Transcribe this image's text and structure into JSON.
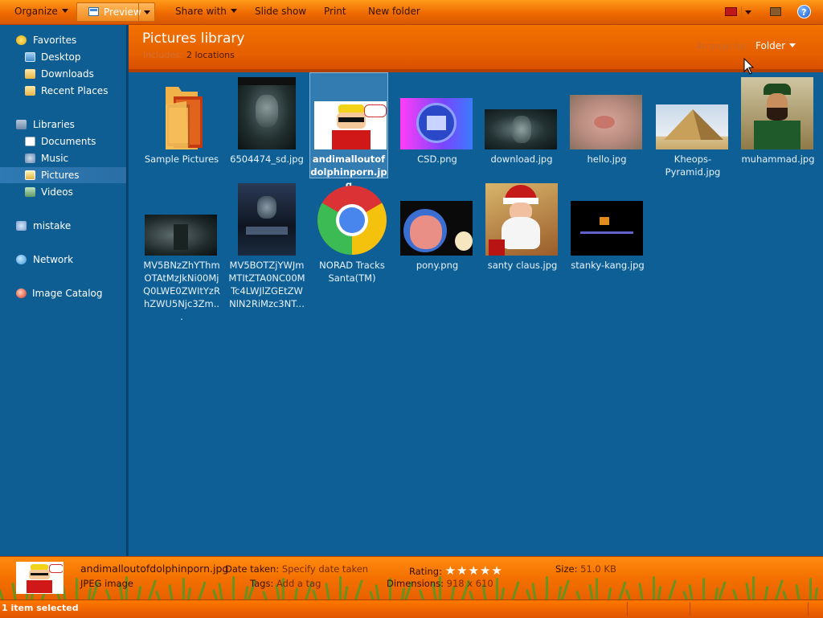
{
  "toolbar": {
    "organize": "Organize",
    "preview": "Preview",
    "share_with": "Share with",
    "slide_show": "Slide show",
    "print": "Print",
    "new_folder": "New folder",
    "help": "?"
  },
  "sidebar": {
    "favorites": "Favorites",
    "favorites_items": [
      "Desktop",
      "Downloads",
      "Recent Places"
    ],
    "libraries": "Libraries",
    "libraries_items": [
      "Documents",
      "Music",
      "Pictures",
      "Videos"
    ],
    "selected": "Pictures",
    "homegroup": "mistake",
    "network": "Network",
    "image_catalog": "Image Catalog"
  },
  "header": {
    "title": "Pictures library",
    "includes": "Includes:",
    "locations": "2 locations",
    "arrange_by_label": "Arrange by:",
    "arrange_by_value": "Folder"
  },
  "files": [
    {
      "name": "Sample Pictures",
      "thumb": "folder-icon"
    },
    {
      "name": "6504474_sd.jpg",
      "thumb": "movie-poster"
    },
    {
      "name": "andimalloutofdolphinporn.jpg",
      "thumb": "cartoon",
      "selected": true
    },
    {
      "name": "CSD.png",
      "thumb": "badge"
    },
    {
      "name": "download.jpg",
      "thumb": "movie-still"
    },
    {
      "name": "hello.jpg",
      "thumb": "photo"
    },
    {
      "name": "Kheops-Pyramid.jpg",
      "thumb": "pyramid"
    },
    {
      "name": "muhammad.jpg",
      "thumb": "painting"
    },
    {
      "name": "MV5BNzZhYThmOTAtMzJkNi00MjQ0LWE0ZWItYzRhZWU5Njc3Zm...",
      "thumb": "movie-still"
    },
    {
      "name": "MV5BOTZjYWJmMTItZTA0NC00MTc4LWJlZGEtZWNlN2RiMzc3NT...",
      "thumb": "movie-poster"
    },
    {
      "name": "NORAD Tracks Santa(TM)",
      "thumb": "chrome-icon"
    },
    {
      "name": "pony.png",
      "thumb": "cartoon"
    },
    {
      "name": "santy claus.jpg",
      "thumb": "photo"
    },
    {
      "name": "stanky-kang.jpg",
      "thumb": "game-screen"
    }
  ],
  "details": {
    "filename": "andimalloutofdolphinporn.jpg",
    "type": "JPEG image",
    "date_taken_label": "Date taken:",
    "date_taken_value": "Specify date taken",
    "tags_label": "Tags:",
    "tags_value": "Add a tag",
    "rating_label": "Rating:",
    "rating_stars": "★★★★★",
    "dimensions_label": "Dimensions:",
    "dimensions_value": "918 x 610",
    "size_label": "Size:",
    "size_value": "51.0 KB"
  },
  "status": {
    "text": "1 item selected"
  },
  "colors": {
    "accent_orange": "#ee6a00",
    "content_blue": "#0d5f96",
    "sidebar_blue": "#0e5e94"
  }
}
